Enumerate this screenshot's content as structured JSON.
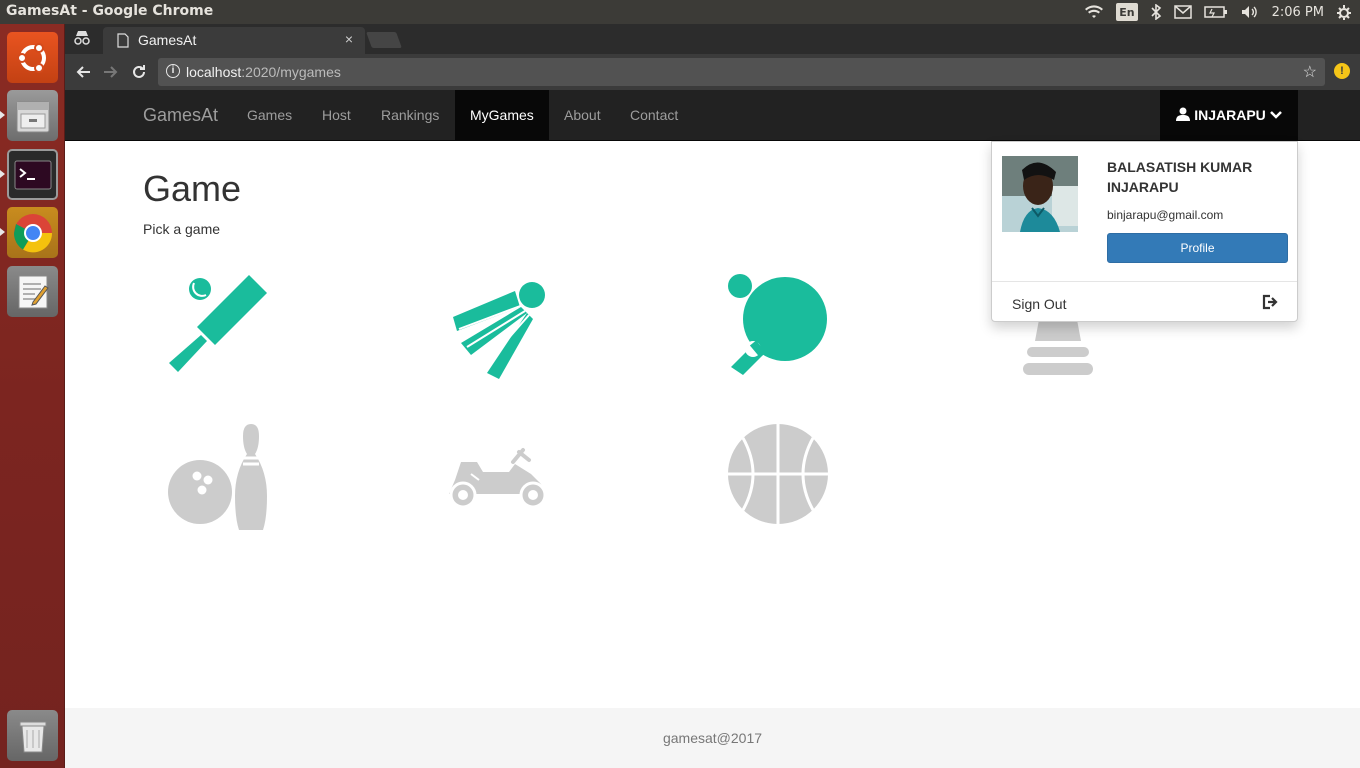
{
  "system": {
    "window_title": "GamesAt - Google Chrome",
    "input_language": "En",
    "clock": "2:06 PM"
  },
  "browser": {
    "tab_title": "GamesAt",
    "tab_close": "×",
    "url_host": "localhost",
    "url_path": ":2020/mygames"
  },
  "navbar": {
    "brand": "GamesAt",
    "links": [
      "Games",
      "Host",
      "Rankings",
      "MyGames",
      "About",
      "Contact"
    ],
    "active": "MyGames",
    "user_label": "INJARAPU"
  },
  "main": {
    "title": "Game",
    "subtitle": "Pick a game",
    "games": [
      {
        "icon": "cricket-icon",
        "available": true
      },
      {
        "icon": "badminton-icon",
        "available": true
      },
      {
        "icon": "table-tennis-icon",
        "available": true
      },
      {
        "icon": "chess-icon",
        "available": false
      },
      {
        "icon": "bowling-icon",
        "available": false
      },
      {
        "icon": "go-kart-icon",
        "available": false
      },
      {
        "icon": "basketball-icon",
        "available": false
      }
    ]
  },
  "user_dropdown": {
    "full_name": "BALASATISH KUMAR INJARAPU",
    "email": "binjarapu@gmail.com",
    "profile_button": "Profile",
    "sign_out": "Sign Out"
  },
  "footer": {
    "text": "gamesat@2017"
  },
  "colors": {
    "active_game": "#1abc9c",
    "inactive_game": "#cccccc",
    "navbar_bg": "#222222",
    "primary_button": "#337ab7"
  }
}
